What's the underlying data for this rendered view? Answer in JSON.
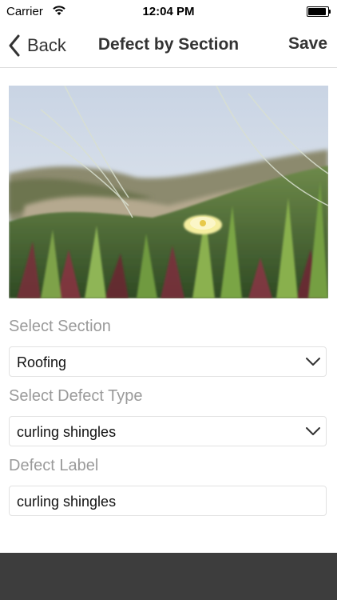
{
  "status_bar": {
    "carrier": "Carrier",
    "time": "12:04 PM",
    "wifi_icon": "wifi-icon",
    "battery_icon": "battery-icon",
    "battery_level": 1.0
  },
  "nav": {
    "back_label": "Back",
    "title": "Defect by Section",
    "save_label": "Save"
  },
  "photo": {
    "icon": "photo-image"
  },
  "form": {
    "section": {
      "label": "Select Section",
      "value": "Roofing"
    },
    "defect_type": {
      "label": "Select Defect Type",
      "value": "curling shingles"
    },
    "defect_label": {
      "label": "Defect Label",
      "value": "curling shingles"
    }
  },
  "colors": {
    "toolbar": "#3d3d3d",
    "label_gray": "#9a9a9a",
    "title_text": "#333333"
  }
}
